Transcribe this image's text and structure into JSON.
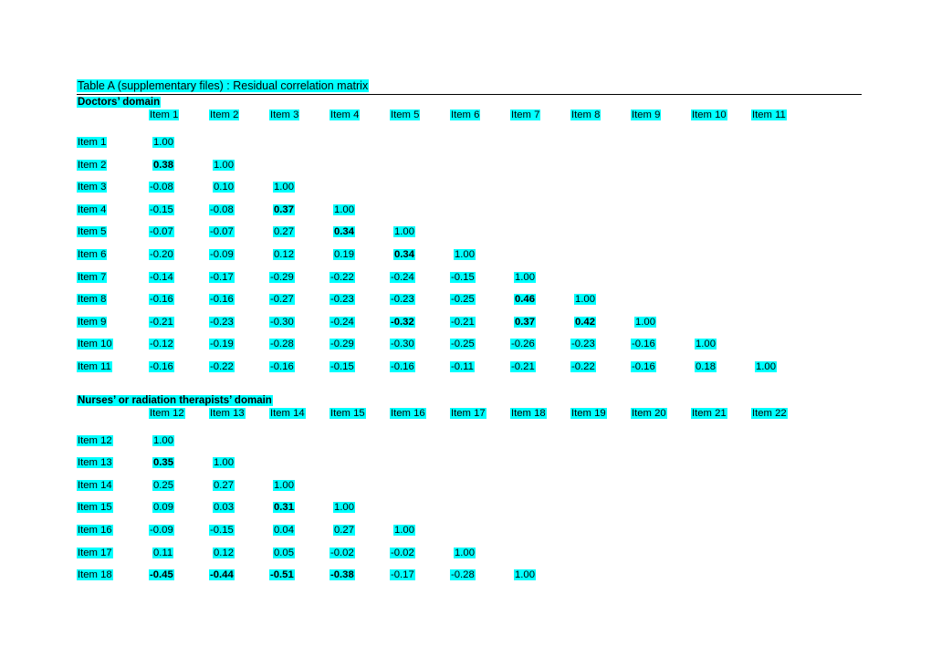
{
  "title": "Table A (supplementary files) : Residual correlation matrix",
  "colors": {
    "highlight": "#00ffff",
    "text": "#000000",
    "rule": "#000000"
  },
  "sections": [
    {
      "heading": "Doctors’ domain",
      "columns": [
        "Item 1",
        "Item 2",
        "Item 3",
        "Item 4",
        "Item 5",
        "Item 6",
        "Item 7",
        "Item 8",
        "Item 9",
        "Item 10",
        "Item 11"
      ],
      "rows": [
        {
          "label": "Item 1",
          "values": [
            "1.00"
          ]
        },
        {
          "label": "Item 2",
          "values": [
            "0.38",
            "1.00"
          ]
        },
        {
          "label": "Item 3",
          "values": [
            "-0.08",
            "0.10",
            "1.00"
          ]
        },
        {
          "label": "Item 4",
          "values": [
            "-0.15",
            "-0.08",
            "0.37",
            "1.00"
          ]
        },
        {
          "label": "Item 5",
          "values": [
            "-0.07",
            "-0.07",
            "0.27",
            "0.34",
            "1.00"
          ]
        },
        {
          "label": "Item 6",
          "values": [
            "-0.20",
            "-0.09",
            "0.12",
            "0.19",
            "0.34",
            "1.00"
          ]
        },
        {
          "label": "Item 7",
          "values": [
            "-0.14",
            "-0.17",
            "-0.29",
            "-0.22",
            "-0.24",
            "-0.15",
            "1.00"
          ]
        },
        {
          "label": "Item 8",
          "values": [
            "-0.16",
            "-0.16",
            "-0.27",
            "-0.23",
            "-0.23",
            "-0.25",
            "0.46",
            "1.00"
          ]
        },
        {
          "label": "Item 9",
          "values": [
            "-0.21",
            "-0.23",
            "-0.30",
            "-0.24",
            "-0.32",
            "-0.21",
            "0.37",
            "0.42",
            "1.00"
          ]
        },
        {
          "label": "Item 10",
          "values": [
            "-0.12",
            "-0.19",
            "-0.28",
            "-0.29",
            "-0.30",
            "-0.25",
            "-0.26",
            "-0.23",
            "-0.16",
            "1.00"
          ]
        },
        {
          "label": "Item 11",
          "values": [
            "-0.16",
            "-0.22",
            "-0.16",
            "-0.15",
            "-0.16",
            "-0.11",
            "-0.21",
            "-0.22",
            "-0.16",
            "0.18",
            "1.00"
          ]
        }
      ],
      "bold": [
        [
          1,
          0
        ],
        [
          3,
          2
        ],
        [
          4,
          3
        ],
        [
          5,
          4
        ],
        [
          8,
          4
        ],
        [
          7,
          6
        ],
        [
          8,
          6
        ],
        [
          8,
          7
        ]
      ]
    },
    {
      "heading": "Nurses’ or radiation therapists’ domain",
      "columns": [
        "Item 12",
        "Item 13",
        "Item 14",
        "Item 15",
        "Item 16",
        "Item 17",
        "Item 18",
        "Item 19",
        "Item 20",
        "Item 21",
        "Item 22"
      ],
      "rows": [
        {
          "label": "Item 12",
          "values": [
            "1.00"
          ]
        },
        {
          "label": "Item 13",
          "values": [
            "0.35",
            "1.00"
          ]
        },
        {
          "label": "Item 14",
          "values": [
            "0.25",
            "0.27",
            "1.00"
          ]
        },
        {
          "label": "Item 15",
          "values": [
            "0.09",
            "0.03",
            "0.31",
            "1.00"
          ]
        },
        {
          "label": "Item 16",
          "values": [
            "-0.09",
            "-0.15",
            "0.04",
            "0.27",
            "1.00"
          ]
        },
        {
          "label": "Item 17",
          "values": [
            "0.11",
            "0.12",
            "0.05",
            "-0.02",
            "-0.02",
            "1.00"
          ]
        },
        {
          "label": "Item 18",
          "values": [
            "-0.45",
            "-0.44",
            "-0.51",
            "-0.38",
            "-0.17",
            "-0.28",
            "1.00"
          ]
        }
      ],
      "bold": [
        [
          1,
          0
        ],
        [
          3,
          2
        ],
        [
          6,
          0
        ],
        [
          6,
          1
        ],
        [
          6,
          2
        ],
        [
          6,
          3
        ]
      ]
    }
  ]
}
